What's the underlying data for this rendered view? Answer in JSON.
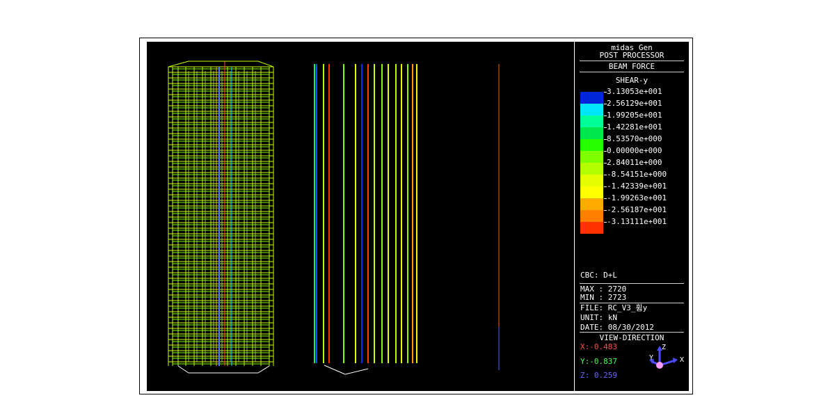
{
  "panel": {
    "app_name": "midas Gen",
    "module": "POST PROCESSOR",
    "result_type": "BEAM FORCE",
    "component": "SHEAR-y",
    "legend": [
      {
        "label": "3.13053e+001",
        "color": "#0026d9"
      },
      {
        "label": "2.56129e+001",
        "color": "#00e6ff"
      },
      {
        "label": "1.99205e+001",
        "color": "#00ff99"
      },
      {
        "label": "1.42281e+001",
        "color": "#00e64d"
      },
      {
        "label": "8.53570e+000",
        "color": "#26ff00"
      },
      {
        "label": "0.00000e+000",
        "color": "#80ff00"
      },
      {
        "label": "2.84011e+000",
        "color": "#b3ff00"
      },
      {
        "label": "-8.54151e+000",
        "color": "#e6ff00"
      },
      {
        "label": "-1.42339e+001",
        "color": "#ffff00"
      },
      {
        "label": "-1.99263e+001",
        "color": "#ffaa00"
      },
      {
        "label": "-2.56187e+001",
        "color": "#ff8000"
      },
      {
        "label": "-3.13111e+001",
        "color": "#ff3300"
      }
    ],
    "load_case": "CBC: D+L",
    "max_label": "MAX : 2720",
    "min_label": "MIN : 2723",
    "file_label": "FILE: RC_V3_휨y",
    "unit_label": "UNIT: kN",
    "date_label": "DATE: 08/30/2012",
    "view_direction_title": "VIEW-DIRECTION",
    "view_x": "X:-0.483",
    "view_y": "Y:-0.837",
    "view_z": "Z: 0.259",
    "axis_x": "X",
    "axis_y": "Y",
    "axis_z": "Z",
    "colors": {
      "x": "#ff4d4d",
      "y": "#4dff4d",
      "z": "#4d4dff"
    }
  }
}
